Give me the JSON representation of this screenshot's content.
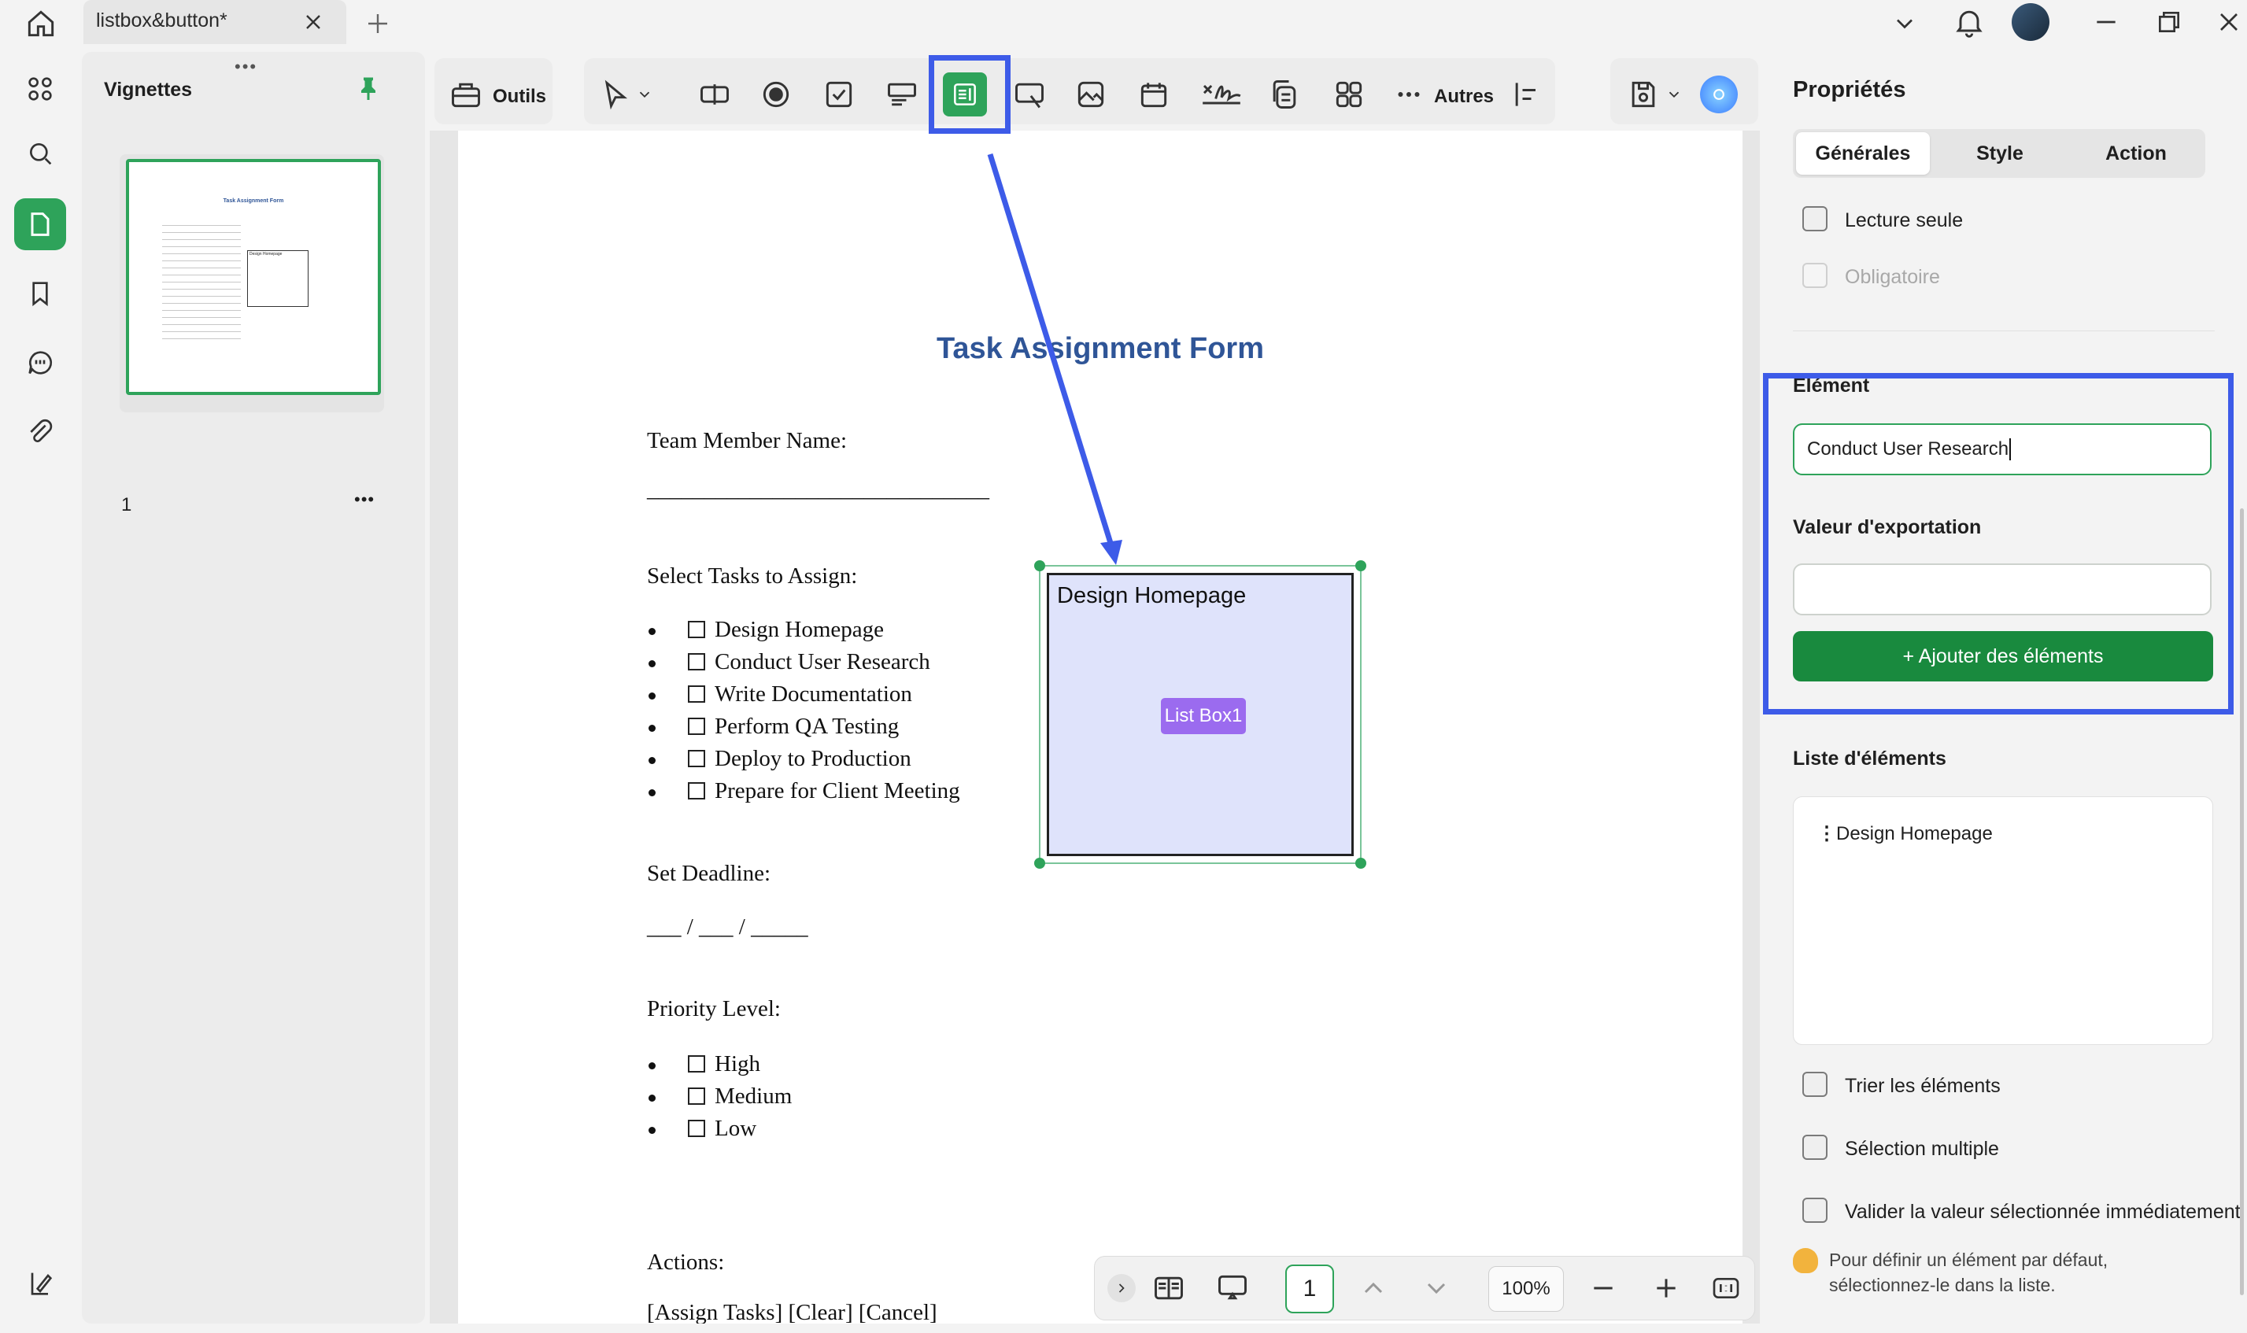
{
  "window": {
    "tab_title": "listbox&button*",
    "accent": "#2ea35a",
    "highlight": "#3d5be8"
  },
  "thumbnails": {
    "title": "Vignettes",
    "page_number": "1",
    "preview_title": "Task Assignment Form",
    "preview_box": "Design Homepage"
  },
  "toolbar": {
    "tools_label": "Outils",
    "more_label": "Autres"
  },
  "document": {
    "title": "Task Assignment Form",
    "team_member_label": "Team Member Name:",
    "underline": "______________________________",
    "select_tasks_label": "Select Tasks to Assign:",
    "tasks": [
      "Design Homepage",
      "Conduct User Research",
      "Write Documentation",
      "Perform QA Testing",
      "Deploy to Production",
      "Prepare for Client Meeting"
    ],
    "deadline_label": "Set Deadline:",
    "deadline_blank": "___ / ___ / _____",
    "priority_label": "Priority Level:",
    "priorities": [
      "High",
      "Medium",
      "Low"
    ],
    "actions_label": "Actions:",
    "actions_line": "[Assign Tasks]   [Clear]   [Cancel]"
  },
  "listbox": {
    "item": "Design Homepage",
    "label": "List Box1"
  },
  "bottom_nav": {
    "page": "1",
    "zoom": "100%"
  },
  "properties": {
    "title": "Propriétés",
    "tabs": [
      "Générales",
      "Style",
      "Action"
    ],
    "read_only": "Lecture seule",
    "required": "Obligatoire",
    "element_label": "Elément",
    "element_value": "Conduct User Research",
    "export_label": "Valeur d'exportation",
    "export_value": "",
    "add_button": "+ Ajouter des éléments",
    "list_label": "Liste d'éléments",
    "list_items": [
      "Design Homepage"
    ],
    "sort_label": "Trier les éléments",
    "multi_label": "Sélection multiple",
    "commit_label": "Valider la valeur sélectionnée immédiatement",
    "hint_line1": "Pour définir un élément par défaut,",
    "hint_line2": "sélectionnez-le dans la liste."
  }
}
